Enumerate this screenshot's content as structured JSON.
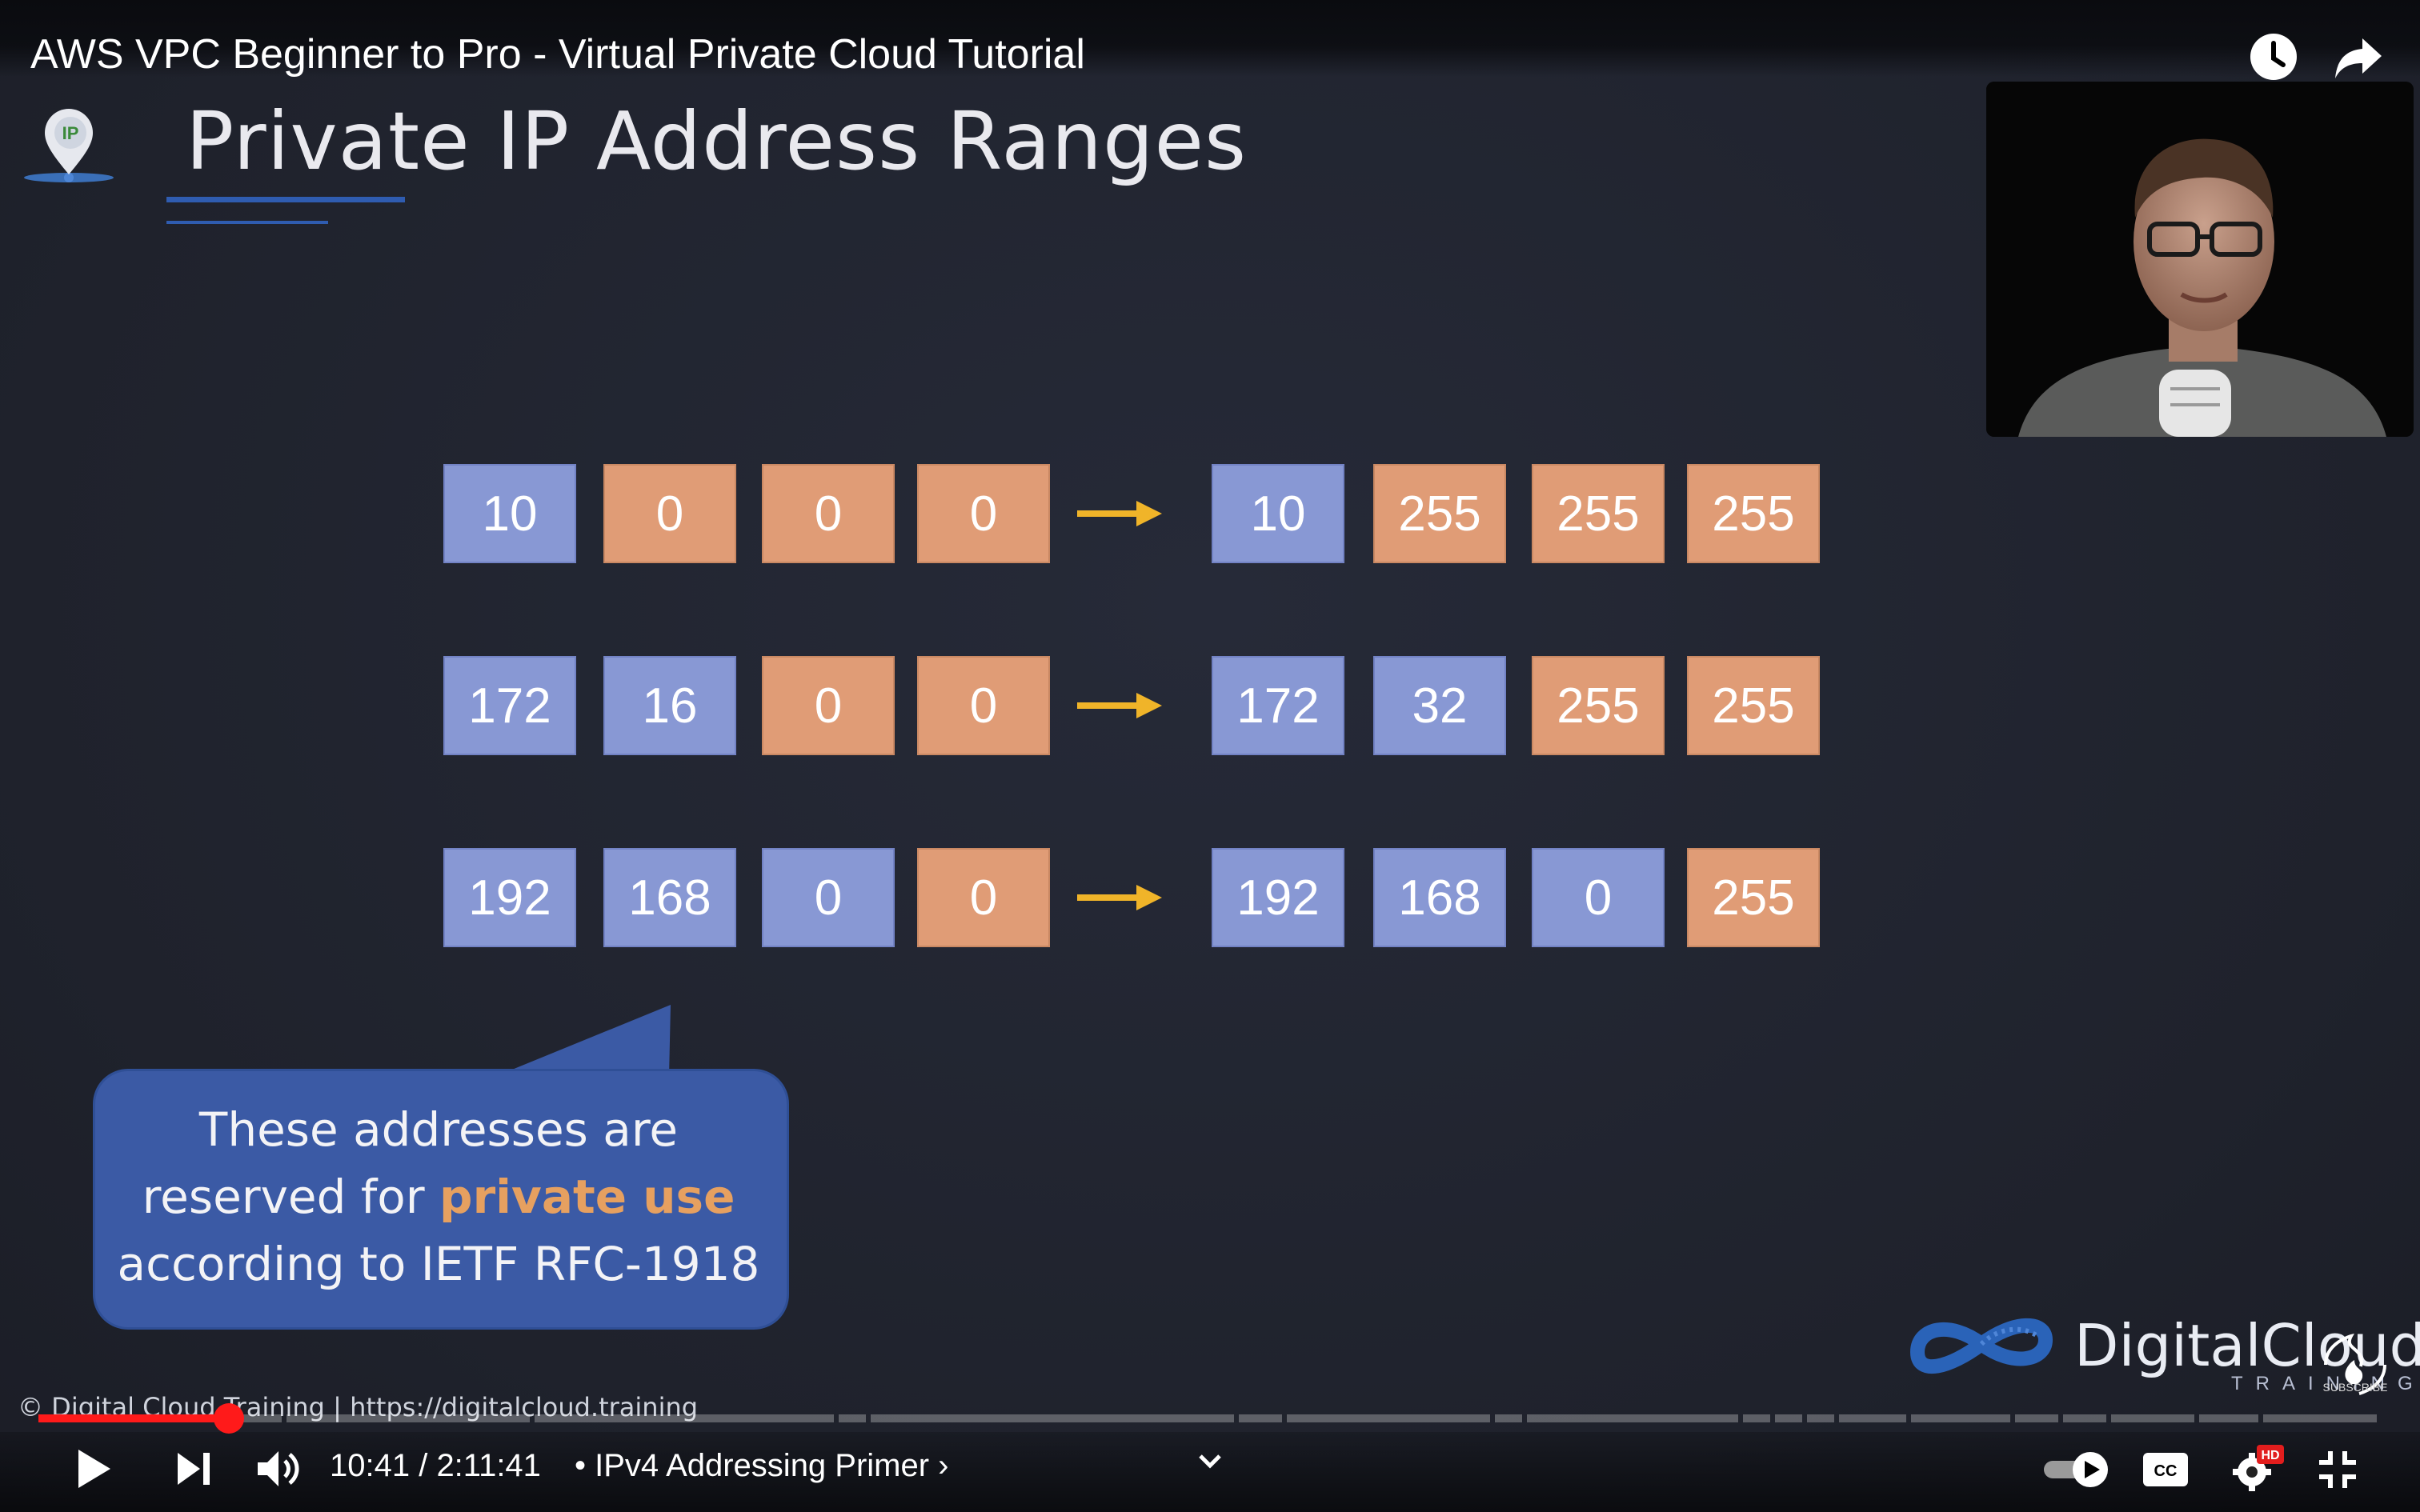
{
  "video": {
    "title": "AWS VPC Beginner to Pro - Virtual Private Cloud Tutorial"
  },
  "slide": {
    "logo_text": "IP",
    "title": "Private IP Address Ranges",
    "ranges": [
      {
        "start": [
          "10",
          "0",
          "0",
          "0"
        ],
        "end": [
          "10",
          "255",
          "255",
          "255"
        ],
        "start_types": [
          "net",
          "host",
          "host",
          "host"
        ],
        "end_types": [
          "net",
          "host",
          "host",
          "host"
        ]
      },
      {
        "start": [
          "172",
          "16",
          "0",
          "0"
        ],
        "end": [
          "172",
          "32",
          "255",
          "255"
        ],
        "start_types": [
          "net",
          "net",
          "host",
          "host"
        ],
        "end_types": [
          "net",
          "net",
          "host",
          "host"
        ]
      },
      {
        "start": [
          "192",
          "168",
          "0",
          "0"
        ],
        "end": [
          "192",
          "168",
          "0",
          "255"
        ],
        "start_types": [
          "net",
          "net",
          "net",
          "host"
        ],
        "end_types": [
          "net",
          "net",
          "net",
          "host"
        ]
      }
    ],
    "callout": {
      "line1": "These addresses are",
      "line2_prefix": "reserved for ",
      "line2_highlight": "private use",
      "line3": "according to IETF RFC-1918"
    },
    "footer": "© Digital Cloud Training  | https://digitalcloud.training",
    "brand": {
      "name": "DigitalCloud",
      "sub": "TRAINING",
      "subscribe": "SUBSCRIBE"
    }
  },
  "player": {
    "current_time": "10:41",
    "duration": "2:11:41",
    "time_display": "10:41 / 2:11:41",
    "chapter": "• IPv4 Addressing Primer ›",
    "progress_fraction": 0.0812,
    "hd_badge": "HD",
    "cc_label": "CC"
  },
  "colors": {
    "network_octet": "#8898d4",
    "host_octet": "#e09c76",
    "arrow": "#f0b429",
    "accent_red": "#ff1a1a",
    "callout": "#3b5aa5",
    "highlight": "#e6a060"
  }
}
